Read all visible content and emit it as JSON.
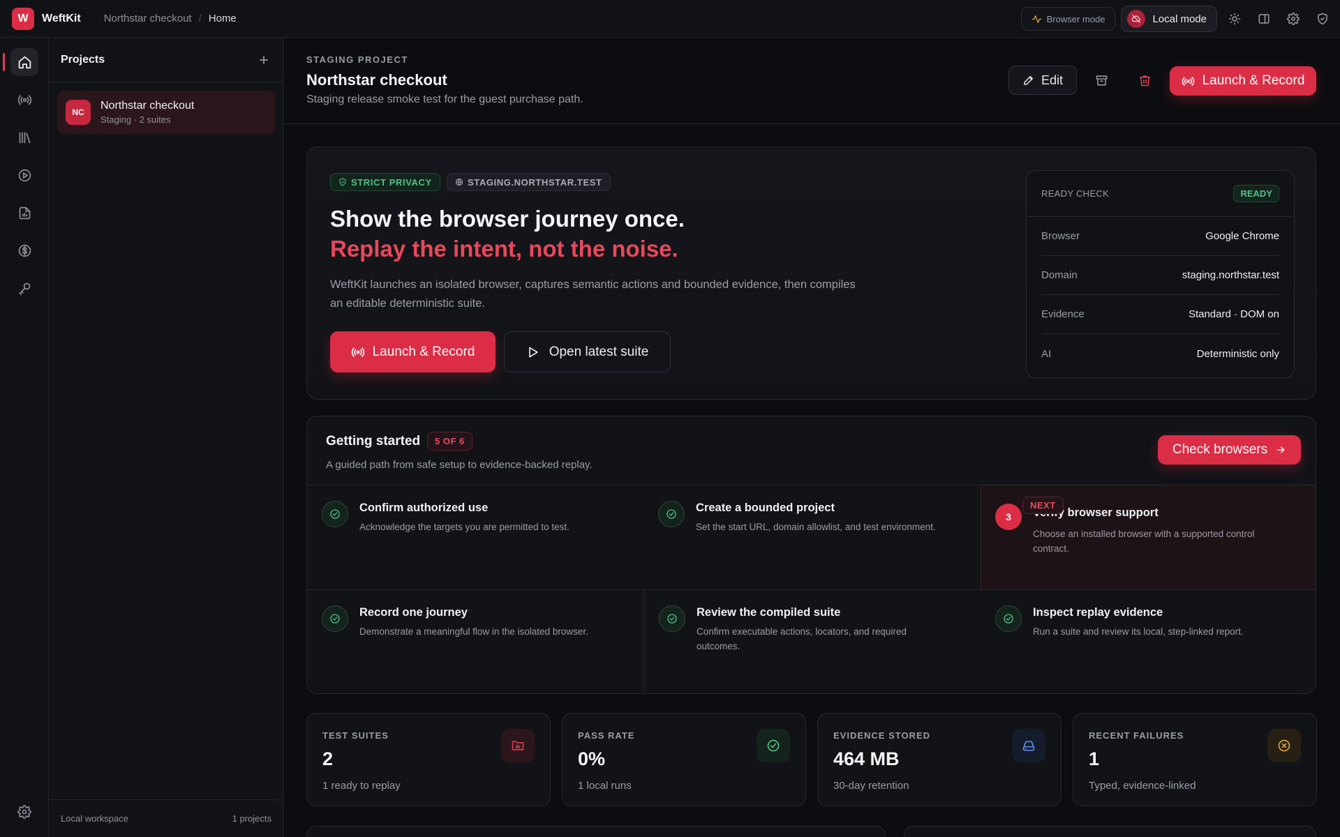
{
  "app": {
    "logo_letter": "W",
    "name": "WeftKit"
  },
  "breadcrumb": [
    "Northstar checkout",
    "Home"
  ],
  "topbar": {
    "browser_mode_label": "Browser mode",
    "local_mode_label": "Local mode",
    "icons": [
      "sun-icon",
      "panel-icon",
      "gear-icon",
      "shield-icon"
    ]
  },
  "rail": {
    "items": [
      "home-icon",
      "broadcast-icon",
      "library-icon",
      "play-circle-icon",
      "report-icon",
      "dollar-icon",
      "key-icon"
    ],
    "bottom": "settings-icon",
    "active_index": 0
  },
  "sidebar": {
    "title": "Projects",
    "project": {
      "initials": "NC",
      "name": "Northstar checkout",
      "meta": "Staging · 2 suites"
    },
    "footer_left": "Local workspace",
    "footer_right": "1 projects"
  },
  "header": {
    "eyebrow": "STAGING PROJECT",
    "title": "Northstar checkout",
    "description": "Staging release smoke test for the guest purchase path.",
    "edit_label": "Edit",
    "launch_label": "Launch & Record"
  },
  "hero": {
    "chips": [
      "STRICT PRIVACY",
      "STAGING.NORTHSTAR.TEST"
    ],
    "headline": "Show the browser journey once.",
    "headline_accent": "Replay the intent, not the noise.",
    "body": "WeftKit launches an isolated browser, captures semantic actions and bounded evidence, then compiles an editable deterministic suite.",
    "launch_label": "Launch & Record",
    "open_label": "Open latest suite"
  },
  "ready_check": {
    "label": "READY CHECK",
    "status": "READY",
    "rows": [
      {
        "key": "Browser",
        "value": "Google Chrome"
      },
      {
        "key": "Domain",
        "value": "staging.northstar.test"
      },
      {
        "key": "Evidence",
        "value": "Standard · DOM on"
      },
      {
        "key": "AI",
        "value": "Deterministic only"
      }
    ]
  },
  "getting_started": {
    "title": "Getting started",
    "count": "5 OF 6",
    "description": "A guided path from safe setup to evidence-backed replay.",
    "button_label": "Check browsers",
    "next_badge": "NEXT",
    "steps": [
      {
        "title": "Confirm authorized use",
        "desc": "Acknowledge the targets you are permitted to test.",
        "done": true
      },
      {
        "title": "Create a bounded project",
        "desc": "Set the start URL, domain allowlist, and test environment.",
        "done": true
      },
      {
        "title": "Verify browser support",
        "desc": "Choose an installed browser with a supported control contract.",
        "done": false,
        "number": "3"
      },
      {
        "title": "Record one journey",
        "desc": "Demonstrate a meaningful flow in the isolated browser.",
        "done": true
      },
      {
        "title": "Review the compiled suite",
        "desc": "Confirm executable actions, locators, and required outcomes.",
        "done": true
      },
      {
        "title": "Inspect replay evidence",
        "desc": "Run a suite and review its local, step-linked report.",
        "done": true
      }
    ]
  },
  "stats": [
    {
      "label": "TEST SUITES",
      "value": "2",
      "sub": "1 ready to replay",
      "icon": "folder-chart-icon",
      "color": "#e23b53"
    },
    {
      "label": "PASS RATE",
      "value": "0%",
      "sub": "1 local runs",
      "icon": "check-circle-icon",
      "color": "#4fbf86"
    },
    {
      "label": "EVIDENCE STORED",
      "value": "464 MB",
      "sub": "30-day retention",
      "icon": "drive-icon",
      "color": "#5b8fe8"
    },
    {
      "label": "RECENT FAILURES",
      "value": "1",
      "sub": "Typed, evidence-linked",
      "icon": "x-circle-icon",
      "color": "#e2a23c"
    }
  ],
  "colors": {
    "accent": "#dc2d46",
    "success": "#4fbf86",
    "background": "#0c0d10"
  }
}
